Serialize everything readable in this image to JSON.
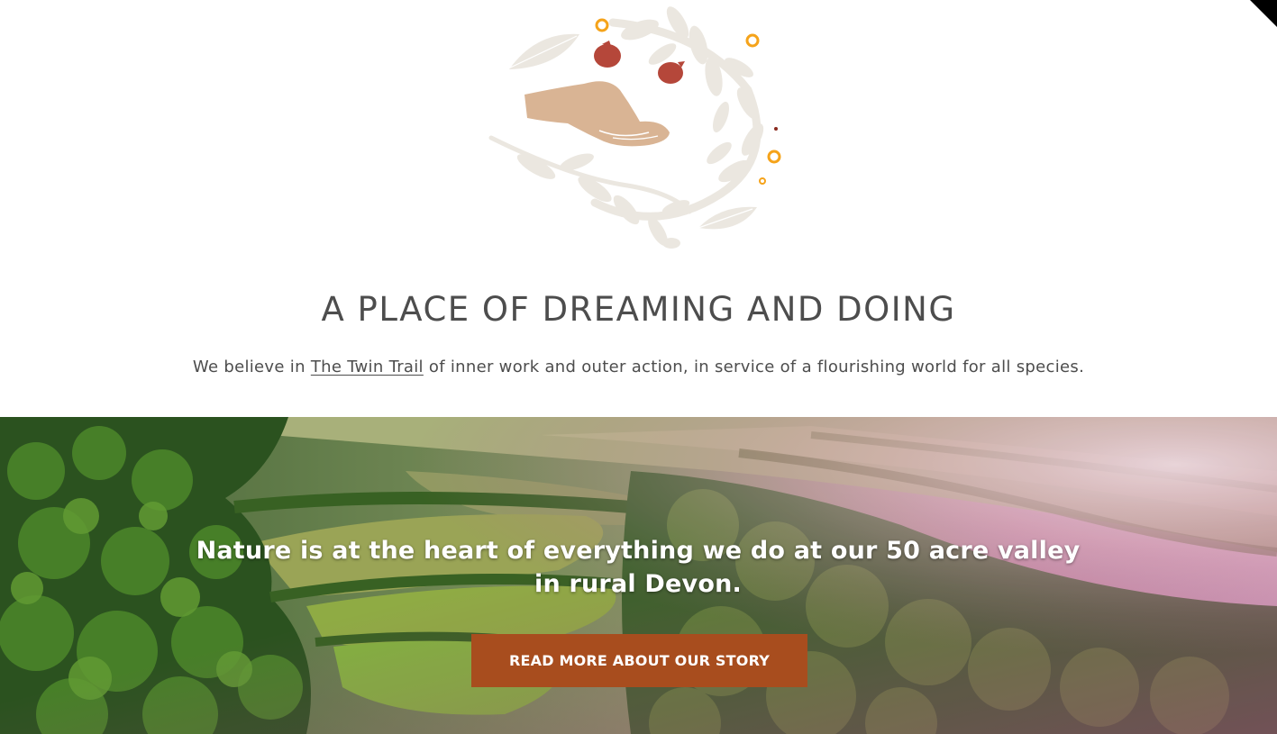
{
  "colors": {
    "heading_text": "#4d4d4d",
    "cta_background": "#a84d1e",
    "cta_text": "#ffffff",
    "emblem_leaf": "#ebe7e0",
    "emblem_hand": "#d9b494",
    "emblem_seed": "#b5473a",
    "emblem_ring": "#f5a31a"
  },
  "emblem": {
    "icon": "hand-with-leaves-emblem"
  },
  "intro": {
    "heading": "A PLACE OF DREAMING AND DOING",
    "text_before": "We believe in ",
    "link_label": "The Twin Trail",
    "text_after": " of inner work and outer action, in service of a flourishing world for all species."
  },
  "hero": {
    "image": "aerial-valley-landscape",
    "line_1": "Nature is at the heart of everything we do at our 50 acre valley",
    "line_2": "in rural Devon.",
    "cta_label": "READ MORE ABOUT OUR STORY"
  }
}
